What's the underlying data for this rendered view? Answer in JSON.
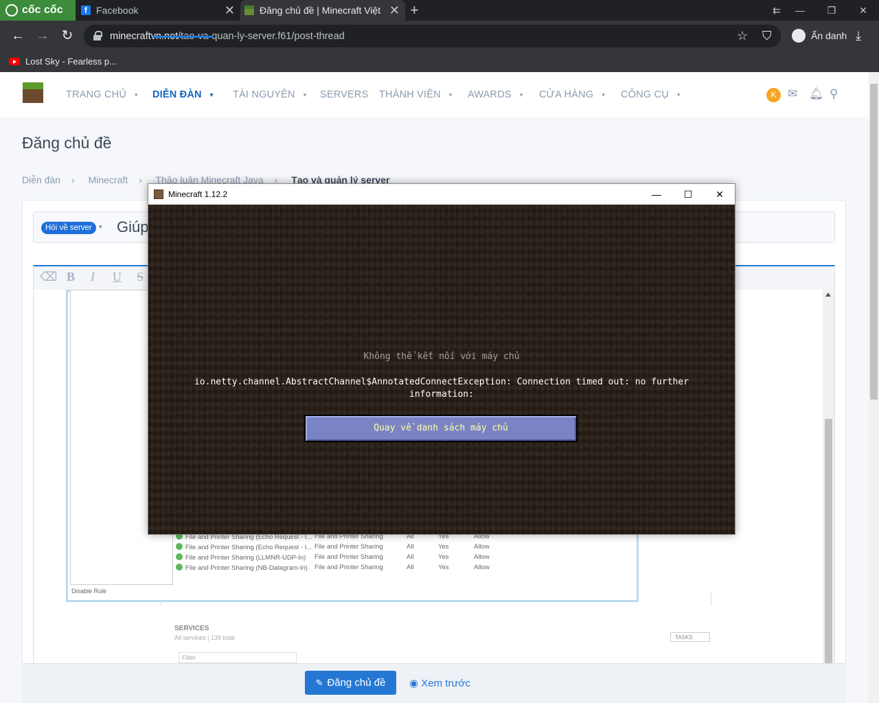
{
  "browser": {
    "brand": "cốc cốc",
    "tabs": [
      {
        "label": "Facebook",
        "icon": "facebook-icon"
      },
      {
        "label": "Đăng chủ đề | Minecraft Việt",
        "icon": "minecraft-icon"
      }
    ],
    "url_host": "minecraftvn.net",
    "url_path": "/tao-va-quan-ly-server.f61/post-thread",
    "incognito_label": "Ẩn danh",
    "bookmark": "Lost Sky - Fearless p..."
  },
  "nav": {
    "items": [
      "TRANG CHỦ",
      "DIỄN ĐÀN",
      "TÀI NGUYÊN",
      "SERVERS",
      "THÀNH VIÊN",
      "AWARDS",
      "CỬA HÀNG",
      "CÔNG CỤ"
    ],
    "active": "DIỄN ĐÀN",
    "avatar_letter": "K"
  },
  "page": {
    "title": "Đăng chủ đề",
    "breadcrumbs": [
      "Diễn đàn",
      "Minecraft",
      "Thảo luận Minecraft Java",
      "Tạo và quản lý server"
    ],
    "prefix": "Hỏi về server",
    "thread_title": "Giúp"
  },
  "editor": {
    "toolbar": [
      "⌫",
      "B",
      "I",
      "U",
      "S"
    ]
  },
  "embedded_screenshot": {
    "rows": [
      {
        "name": "File and Printer Sharing (Echo Request - I...",
        "group": "File and Printer Sharing",
        "profile": "All",
        "enabled": "Yes",
        "action": "Allow"
      },
      {
        "name": "File and Printer Sharing (Echo Request - I...",
        "group": "File and Printer Sharing",
        "profile": "All",
        "enabled": "Yes",
        "action": "Allow"
      },
      {
        "name": "File and Printer Sharing (LLMNR-UDP-In)",
        "group": "File and Printer Sharing",
        "profile": "All",
        "enabled": "Yes",
        "action": "Allow"
      },
      {
        "name": "File and Printer Sharing (NB-Datagram-In)",
        "group": "File and Printer Sharing",
        "profile": "All",
        "enabled": "Yes",
        "action": "Allow"
      }
    ],
    "disable_rule": "Disable Rule",
    "services_title": "SERVICES",
    "services_sub": "All services | 139 total",
    "tasks": "TASKS",
    "filter_placeholder": "Filter"
  },
  "actions": {
    "post_label": "Đăng chủ đề",
    "preview_label": "Xem trước"
  },
  "minecraft": {
    "window_title": "Minecraft 1.12.2",
    "heading": "Không thể kết nối với máy chủ",
    "error": "io.netty.channel.AbstractChannel$AnnotatedConnectException: Connection timed out: no further information:",
    "button": "Quay về danh sách máy chủ"
  }
}
